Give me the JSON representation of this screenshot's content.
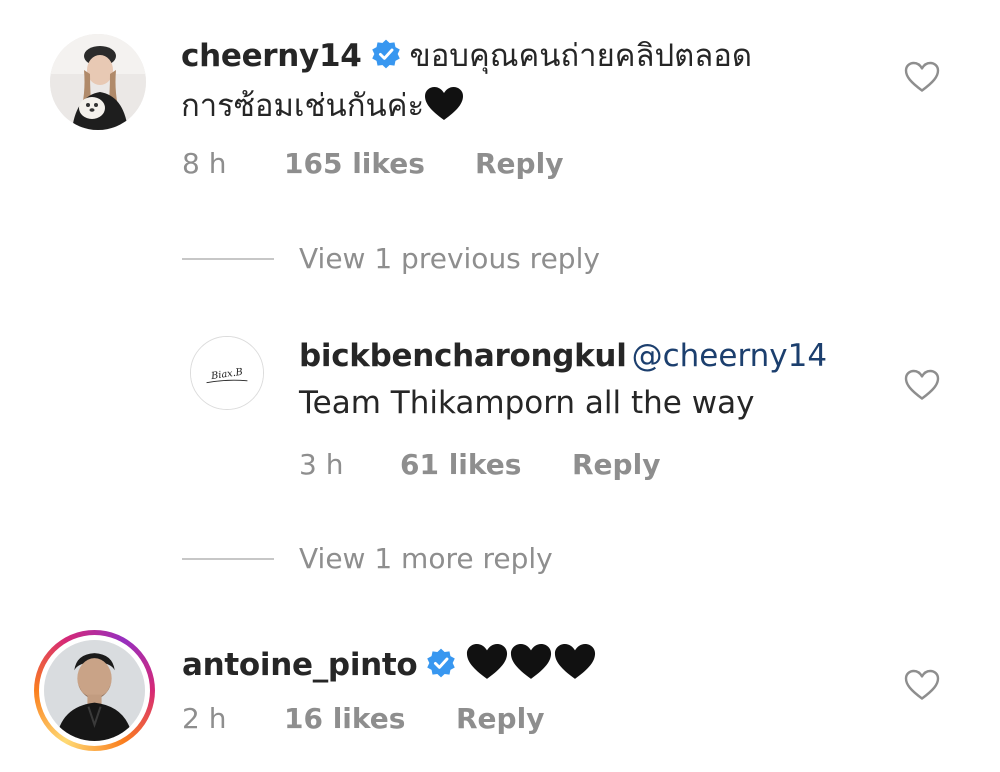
{
  "comments": [
    {
      "username": "cheerny14",
      "verified": true,
      "text_line1": "ขอบคุณคนถ่ายคลิปตลอด",
      "text_line2": "การซ้อมเช่นกันค่ะ",
      "emoji": "black-heart",
      "time": "8 h",
      "likes": "165 likes",
      "reply_label": "Reply"
    },
    {
      "view_replies": "View 1 previous reply"
    },
    {
      "username": "bickbencharongkul",
      "verified": false,
      "mention": "@cheerny14",
      "text": "Team Thikamporn all the way",
      "avatar_text": "Biax.B",
      "time": "3 h",
      "likes": "61 likes",
      "reply_label": "Reply"
    },
    {
      "view_replies": "View 1 more reply"
    },
    {
      "username": "antoine_pinto",
      "verified": true,
      "emoji_count": 3,
      "time": "2 h",
      "likes": "16 likes",
      "reply_label": "Reply"
    }
  ],
  "icons": {
    "verified": "verified-badge-icon",
    "like": "heart-outline-icon",
    "emoji": "black-heart"
  },
  "colors": {
    "verified_blue": "#3897f0",
    "mention": "#1c3f6e",
    "meta_gray": "#8e8e8e"
  }
}
